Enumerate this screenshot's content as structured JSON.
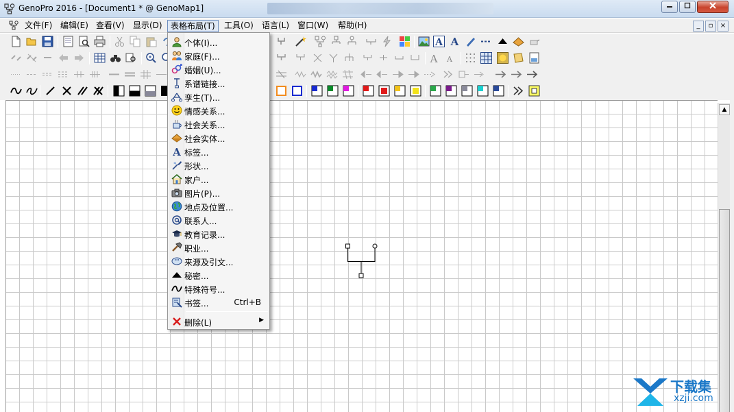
{
  "window": {
    "title": "GenoPro 2016 - [Document1 * @ GenoMap1]"
  },
  "menubar": {
    "items": [
      {
        "label": "文件(F)"
      },
      {
        "label": "编辑(E)"
      },
      {
        "label": "查看(V)"
      },
      {
        "label": "显示(D)"
      },
      {
        "label": "表格布局(T)"
      },
      {
        "label": "工具(O)"
      },
      {
        "label": "语言(L)"
      },
      {
        "label": "窗口(W)"
      },
      {
        "label": "帮助(H)"
      }
    ],
    "active": "表格布局(T)"
  },
  "dropdown": {
    "items": [
      {
        "label": "个体(I)...",
        "icon": "person-icon"
      },
      {
        "label": "家庭(F)...",
        "icon": "family-icon"
      },
      {
        "label": "婚姻(U)...",
        "icon": "marriage-icon"
      },
      {
        "label": "系谱链接...",
        "icon": "pedigree-link-icon"
      },
      {
        "label": "孪生(T)...",
        "icon": "twins-icon"
      },
      {
        "label": "情感关系...",
        "icon": "smiley-icon"
      },
      {
        "label": "社会关系...",
        "icon": "social-relationship-icon"
      },
      {
        "label": "社会实体...",
        "icon": "social-entity-icon"
      },
      {
        "label": "标签...",
        "icon": "label-icon"
      },
      {
        "label": "形状...",
        "icon": "shape-icon"
      },
      {
        "label": "家户...",
        "icon": "house-icon"
      },
      {
        "label": "图片(P)...",
        "icon": "camera-icon"
      },
      {
        "label": "地点及位置...",
        "icon": "globe-icon"
      },
      {
        "label": "联系人...",
        "icon": "contact-icon"
      },
      {
        "label": "教育记录...",
        "icon": "graduation-icon"
      },
      {
        "label": "职业...",
        "icon": "hammer-icon"
      },
      {
        "label": "来源及引文...",
        "icon": "quote-icon"
      },
      {
        "label": "秘密...",
        "icon": "secret-icon"
      },
      {
        "label": "特殊符号...",
        "icon": "symbol-icon"
      },
      {
        "label": "书签...",
        "icon": "bookmark-icon",
        "shortcut": "Ctrl+B"
      }
    ],
    "delete_item": {
      "label": "删除(L)",
      "icon": "delete-icon"
    }
  },
  "watermark": {
    "brand": "下载集",
    "url": "xzji.com"
  },
  "colors": {
    "accent": "#1b78c8",
    "menu_active": "#dfe8f5",
    "grid": "#c9c9c9"
  }
}
